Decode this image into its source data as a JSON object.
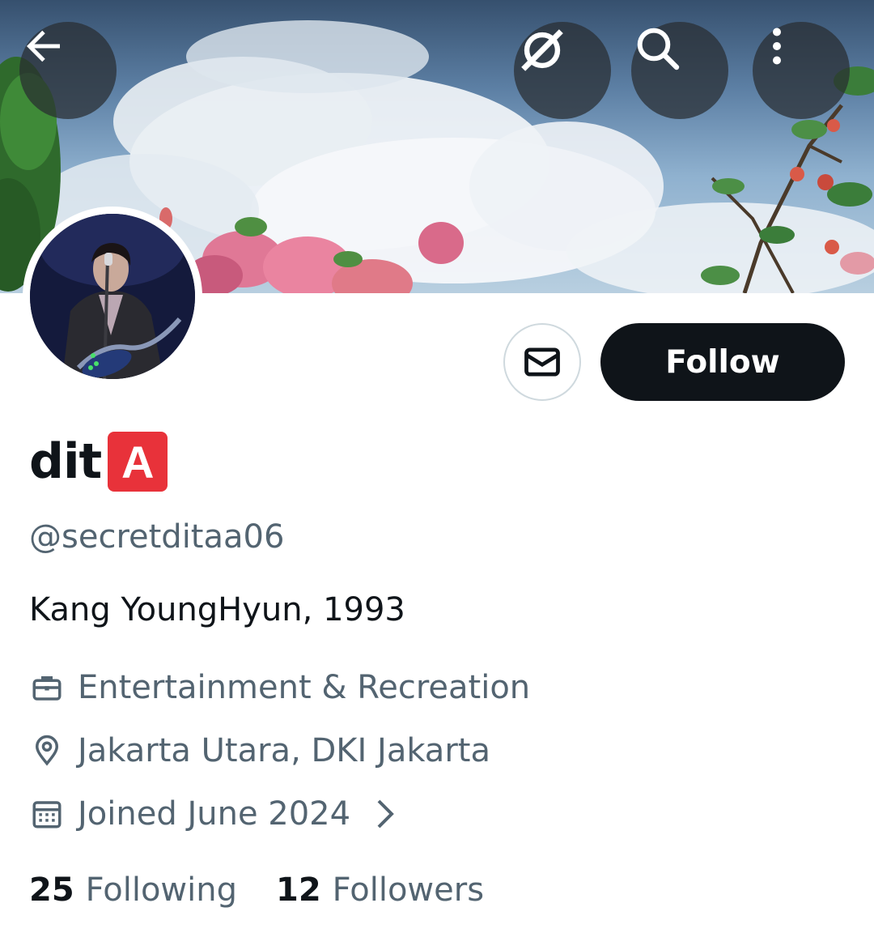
{
  "header": {
    "back_icon": "arrow-left-icon",
    "grok_icon": "grok-icon",
    "search_icon": "search-icon",
    "more_icon": "more-vertical-icon"
  },
  "profile": {
    "display_name": "dit",
    "name_badge": "A",
    "handle": "@secretditaa06",
    "bio": "Kang YoungHyun, 1993",
    "category": "Entertainment & Recreation",
    "location": "Jakarta Utara, DKI Jakarta",
    "joined": "Joined June 2024"
  },
  "actions": {
    "follow_label": "Follow",
    "message_icon": "mail-icon"
  },
  "stats": {
    "following_count": "25",
    "following_label": "Following",
    "followers_count": "12",
    "followers_label": "Followers"
  },
  "colors": {
    "primary_text": "#0f1419",
    "secondary_text": "#536471",
    "follow_button": "#0f1419",
    "badge": "#e8323a"
  }
}
